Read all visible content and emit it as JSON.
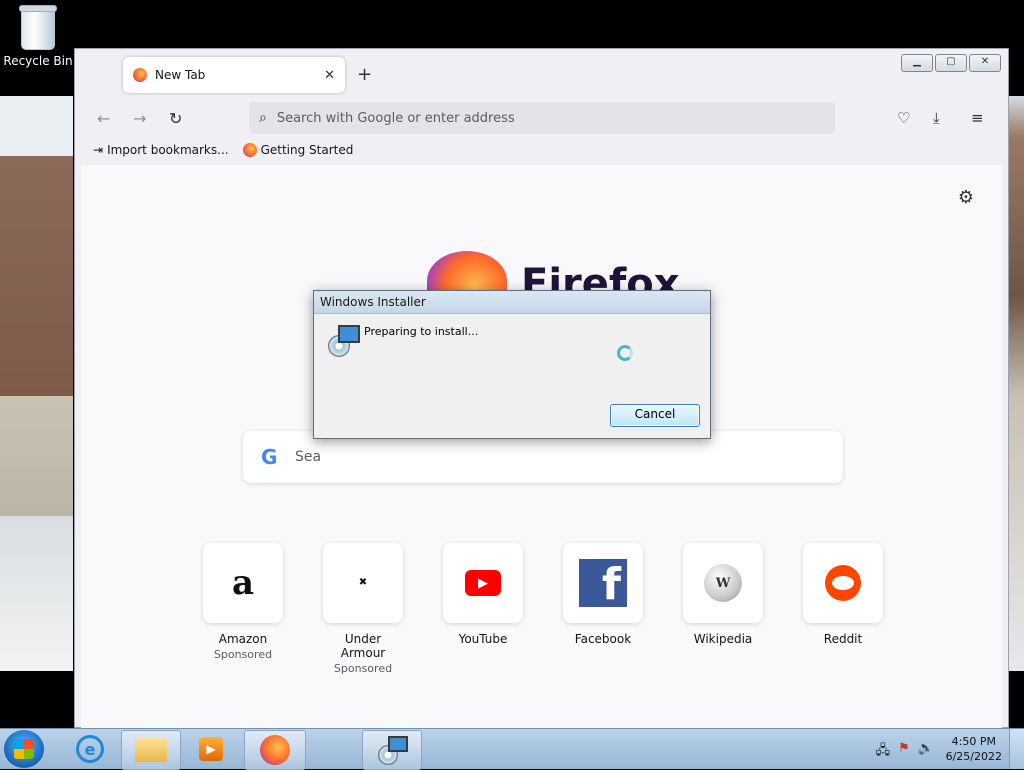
{
  "desktop": {
    "recycle_bin_label": "Recycle Bin"
  },
  "browser": {
    "tab": {
      "title": "New Tab",
      "close_glyph": "✕"
    },
    "new_tab_glyph": "+",
    "caption": {
      "minimize": "▁",
      "maximize": "▢",
      "close": "✕"
    },
    "toolbar": {
      "back_glyph": "←",
      "forward_glyph": "→",
      "reload_glyph": "↻",
      "search_placeholder": "Search with Google or enter address",
      "pocket_glyph": "♡",
      "download_glyph": "⤓",
      "menu_glyph": "≡"
    },
    "bookmarks": {
      "import": "Import bookmarks...",
      "getting_started": "Getting Started"
    },
    "newtab": {
      "brand": "Firefox",
      "search_partial": "Sea",
      "settings_glyph": "⚙",
      "tiles": [
        {
          "label": "Amazon",
          "sponsored": "Sponsored",
          "icon": "amazon-icon"
        },
        {
          "label": "Under Armour",
          "sponsored": "Sponsored",
          "icon": "under-armour-icon"
        },
        {
          "label": "YouTube",
          "sponsored": "",
          "icon": "youtube-icon"
        },
        {
          "label": "Facebook",
          "sponsored": "",
          "icon": "facebook-icon"
        },
        {
          "label": "Wikipedia",
          "sponsored": "",
          "icon": "wikipedia-icon"
        },
        {
          "label": "Reddit",
          "sponsored": "",
          "icon": "reddit-icon"
        }
      ]
    }
  },
  "installer": {
    "title": "Windows Installer",
    "message": "Preparing to install...",
    "cancel_label": "Cancel"
  },
  "taskbar": {
    "time": "4:50 PM",
    "date": "6/25/2022"
  },
  "colors": {
    "firefox_accent": "#ff6a2b",
    "taskbar_top": "#bcd3ea",
    "dialog_button": "#bee6fd"
  }
}
